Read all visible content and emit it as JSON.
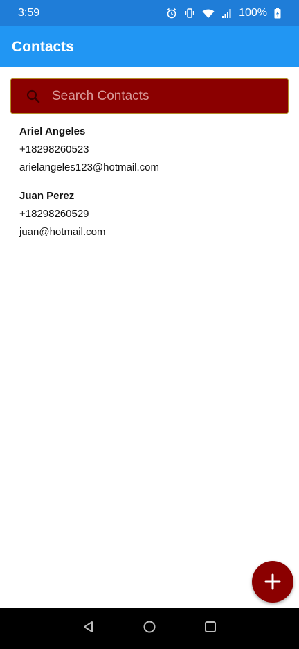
{
  "status_bar": {
    "time": "3:59",
    "battery": "100%",
    "icons": [
      "alarm-icon",
      "vibrate-icon",
      "wifi-icon",
      "signal-icon",
      "battery-charging-icon"
    ]
  },
  "app_bar": {
    "title": "Contacts"
  },
  "search": {
    "placeholder": "Search Contacts",
    "value": "",
    "icon": "search-icon"
  },
  "contacts": [
    {
      "name": "Ariel Angeles",
      "phone": "+18298260523",
      "email": "arielangeles123@hotmail.com"
    },
    {
      "name": "Juan Perez",
      "phone": "+18298260529",
      "email": "juan@hotmail.com"
    }
  ],
  "fab": {
    "icon": "plus-icon"
  },
  "nav_bar": {
    "icons": [
      "back-icon",
      "home-icon",
      "recents-icon"
    ]
  },
  "colors": {
    "status_bar": "#1f7dd8",
    "app_bar": "#2196f3",
    "accent": "#8b0000",
    "nav_bar": "#000000"
  }
}
